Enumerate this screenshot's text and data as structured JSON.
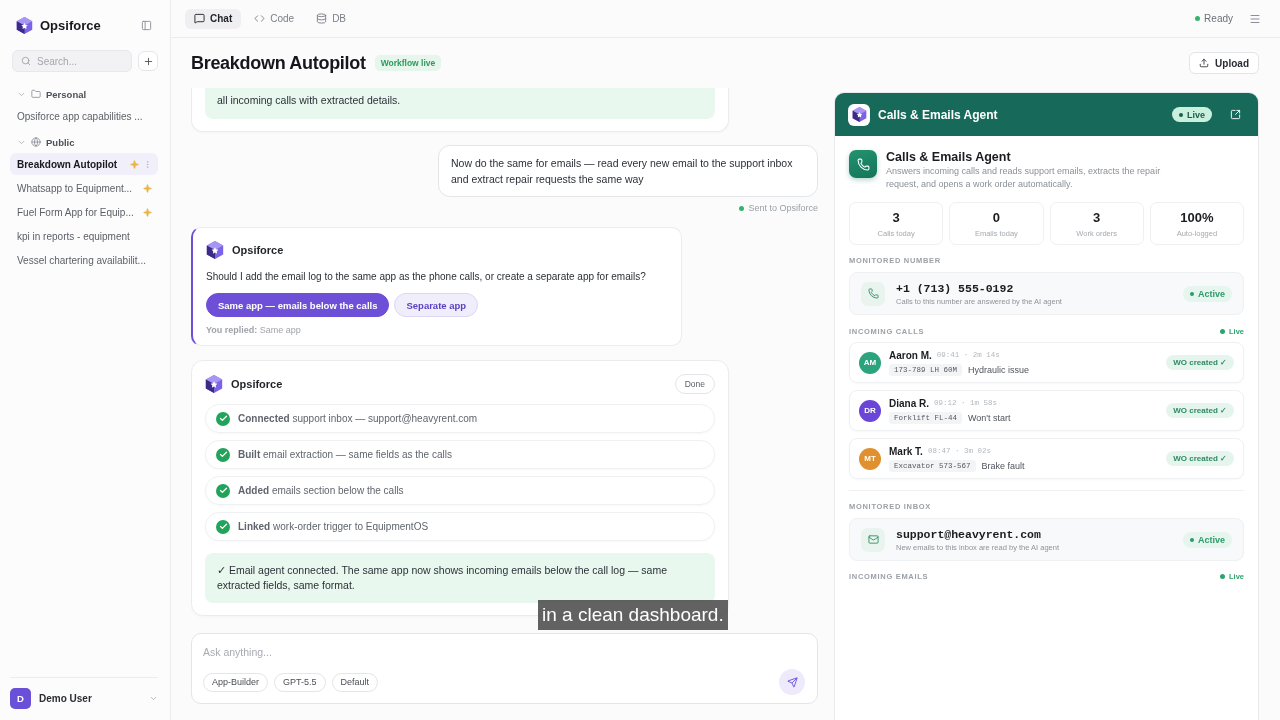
{
  "sidebar": {
    "brand": "Opsiforce",
    "search": {
      "placeholder": "Search..."
    },
    "groups": [
      {
        "label": "Personal",
        "kind": "folder",
        "expanded": true,
        "items": [
          {
            "label": "Opsiforce app capabilities ...",
            "selected": false,
            "starred": false
          }
        ]
      },
      {
        "label": "Public",
        "kind": "globe",
        "expanded": true,
        "items": [
          {
            "label": "Breakdown Autopilot",
            "selected": true,
            "starred": true
          },
          {
            "label": "Whatsapp to Equipment...",
            "selected": false,
            "starred": true
          },
          {
            "label": "Fuel Form App for Equip...",
            "selected": false,
            "starred": true
          },
          {
            "label": "kpi in reports - equipment",
            "selected": false,
            "starred": false
          },
          {
            "label": "Vessel chartering availabilit...",
            "selected": false,
            "starred": false
          }
        ]
      }
    ],
    "user": {
      "initial": "D",
      "name": "Demo User"
    }
  },
  "topbar": {
    "tabs": [
      {
        "label": "Chat",
        "kind": "chat",
        "selected": true
      },
      {
        "label": "Code",
        "kind": "code",
        "selected": false
      },
      {
        "label": "DB",
        "kind": "db",
        "selected": false
      }
    ],
    "status": "Ready"
  },
  "header": {
    "title": "Breakdown Autopilot",
    "badge": "Workflow live",
    "upload": "Upload"
  },
  "chat": {
    "messages": [
      {
        "kind": "result",
        "text": "all incoming calls with extracted details."
      },
      {
        "kind": "user",
        "text": "Now do the same for emails — read every new email to the support inbox and extract repair requests the same way",
        "status": "Sent to Opsiforce"
      },
      {
        "kind": "question",
        "sender": "Opsiforce",
        "text": "Should I add the email log to the same app as the phone calls, or create a separate app for emails?",
        "options": [
          {
            "label": "Same app — emails below the calls",
            "selected": true
          },
          {
            "label": "Separate app",
            "selected": false
          }
        ],
        "reply": "**You replied:** Same app"
      },
      {
        "kind": "steps",
        "sender": "Opsiforce",
        "status": "Done",
        "steps": [
          {
            "text": "**Connected** support inbox — support@heavyrent.com",
            "done": true
          },
          {
            "text": "**Built** email extraction — same fields as the calls",
            "done": true
          },
          {
            "text": "**Added** emails section below the calls",
            "done": true
          },
          {
            "text": "**Linked** work-order trigger to EquipmentOS",
            "done": true
          }
        ],
        "summary": "✓ Email agent connected. The same app now shows incoming emails below the call log — same extracted fields, same format."
      }
    ]
  },
  "composer": {
    "placeholder": "Ask anything...",
    "chips": [
      "App-Builder",
      "GPT-5.5",
      "Default"
    ]
  },
  "caption": "in a clean dashboard.",
  "agent": {
    "header": {
      "title": "Calls & Emails Agent",
      "badge": "Live"
    },
    "title": "Calls & Emails Agent",
    "description": "Answers incoming calls and reads support emails, extracts the repair request, and opens a work order automatically.",
    "stats": [
      {
        "value": "3",
        "label": "Calls today"
      },
      {
        "value": "0",
        "label": "Emails today"
      },
      {
        "value": "3",
        "label": "Work orders"
      },
      {
        "value": "100%",
        "label": "Auto-logged"
      }
    ],
    "monitored_number": {
      "heading": "MONITORED NUMBER",
      "value": "+1 (713) 555-0192",
      "note": "Calls to this number are answered by the AI agent",
      "status": "Active"
    },
    "incoming_calls": {
      "heading": "INCOMING CALLS",
      "badge": "Live",
      "calls": [
        {
          "initials": "AM",
          "color": "#2ba37c",
          "name": "Aaron M.",
          "time": "09:41 · 2m 14s",
          "asset": "173-789 LH 60M",
          "issue": "Hydraulic issue",
          "status": "WO created ✓"
        },
        {
          "initials": "DR",
          "color": "#6a45d8",
          "name": "Diana R.",
          "time": "09:12 · 1m 58s",
          "asset": "Forklift FL-44",
          "issue": "Won't start",
          "status": "WO created ✓"
        },
        {
          "initials": "MT",
          "color": "#e0902f",
          "name": "Mark T.",
          "time": "08:47 · 3m 02s",
          "asset": "Excavator 573-567",
          "issue": "Brake fault",
          "status": "WO created ✓"
        }
      ]
    },
    "monitored_inbox": {
      "heading": "MONITORED INBOX",
      "value": "support@heavyrent.com",
      "note": "New emails to this inbox are read by the AI agent",
      "status": "Active"
    },
    "incoming_emails": {
      "heading": "INCOMING EMAILS",
      "badge": "Live"
    }
  }
}
